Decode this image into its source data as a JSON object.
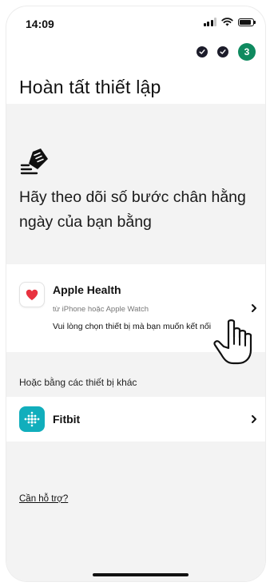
{
  "status_bar": {
    "time": "14:09"
  },
  "progress": {
    "current_step": "3"
  },
  "page": {
    "title": "Hoàn tất thiết lập"
  },
  "hero": {
    "icon": "shoe-icon",
    "text": "Hãy theo dõi số bước chân hằng ngày của bạn bằng"
  },
  "apple_health": {
    "title": "Apple Health",
    "subtitle": "từ iPhone hoặc Apple Watch",
    "instruction": "Vui lòng chọn thiết bị mà bạn muốn kết nối",
    "icon": "heart-icon"
  },
  "other_devices": {
    "label": "Hoặc bằng các thiết bị khác",
    "items": [
      {
        "title": "Fitbit",
        "icon": "fitbit-icon"
      }
    ]
  },
  "help": {
    "label": "Cần hỗ trợ?"
  },
  "colors": {
    "accent": "#0f8a5f",
    "fitbit": "#11aebc",
    "heart": "#e8323f",
    "background": "#f3f3f3"
  }
}
